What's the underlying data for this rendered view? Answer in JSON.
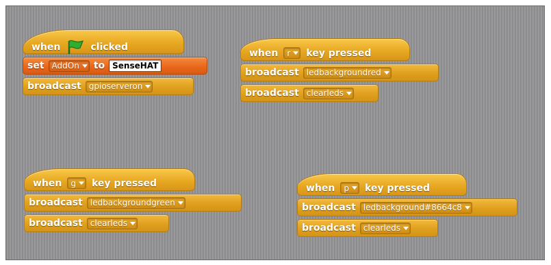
{
  "scripts": [
    {
      "hat": {
        "prefix": "when",
        "suffix": "clicked",
        "icon": "green-flag-icon"
      },
      "blocks": [
        {
          "set_label": "set",
          "variable": "AddOn",
          "to_label": "to",
          "value": "SenseHAT"
        },
        {
          "label": "broadcast",
          "message": "gpioserveron"
        }
      ]
    },
    {
      "hat": {
        "prefix": "when",
        "key": "r",
        "suffix": "key pressed"
      },
      "blocks": [
        {
          "label": "broadcast",
          "message": "ledbackgroundred"
        },
        {
          "label": "broadcast",
          "message": "clearleds"
        }
      ]
    },
    {
      "hat": {
        "prefix": "when",
        "key": "g",
        "suffix": "key pressed"
      },
      "blocks": [
        {
          "label": "broadcast",
          "message": "ledbackgroundgreen"
        },
        {
          "label": "broadcast",
          "message": "clearleds"
        }
      ]
    },
    {
      "hat": {
        "prefix": "when",
        "key": "p",
        "suffix": "key pressed"
      },
      "blocks": [
        {
          "label": "broadcast",
          "message": "ledbackground#8664c8"
        },
        {
          "label": "broadcast",
          "message": "clearleds"
        }
      ]
    }
  ],
  "colors": {
    "events_block": "#e6a620",
    "variables_block": "#e8661a",
    "flag": "#2fae2f",
    "stage_background": "#909093"
  }
}
